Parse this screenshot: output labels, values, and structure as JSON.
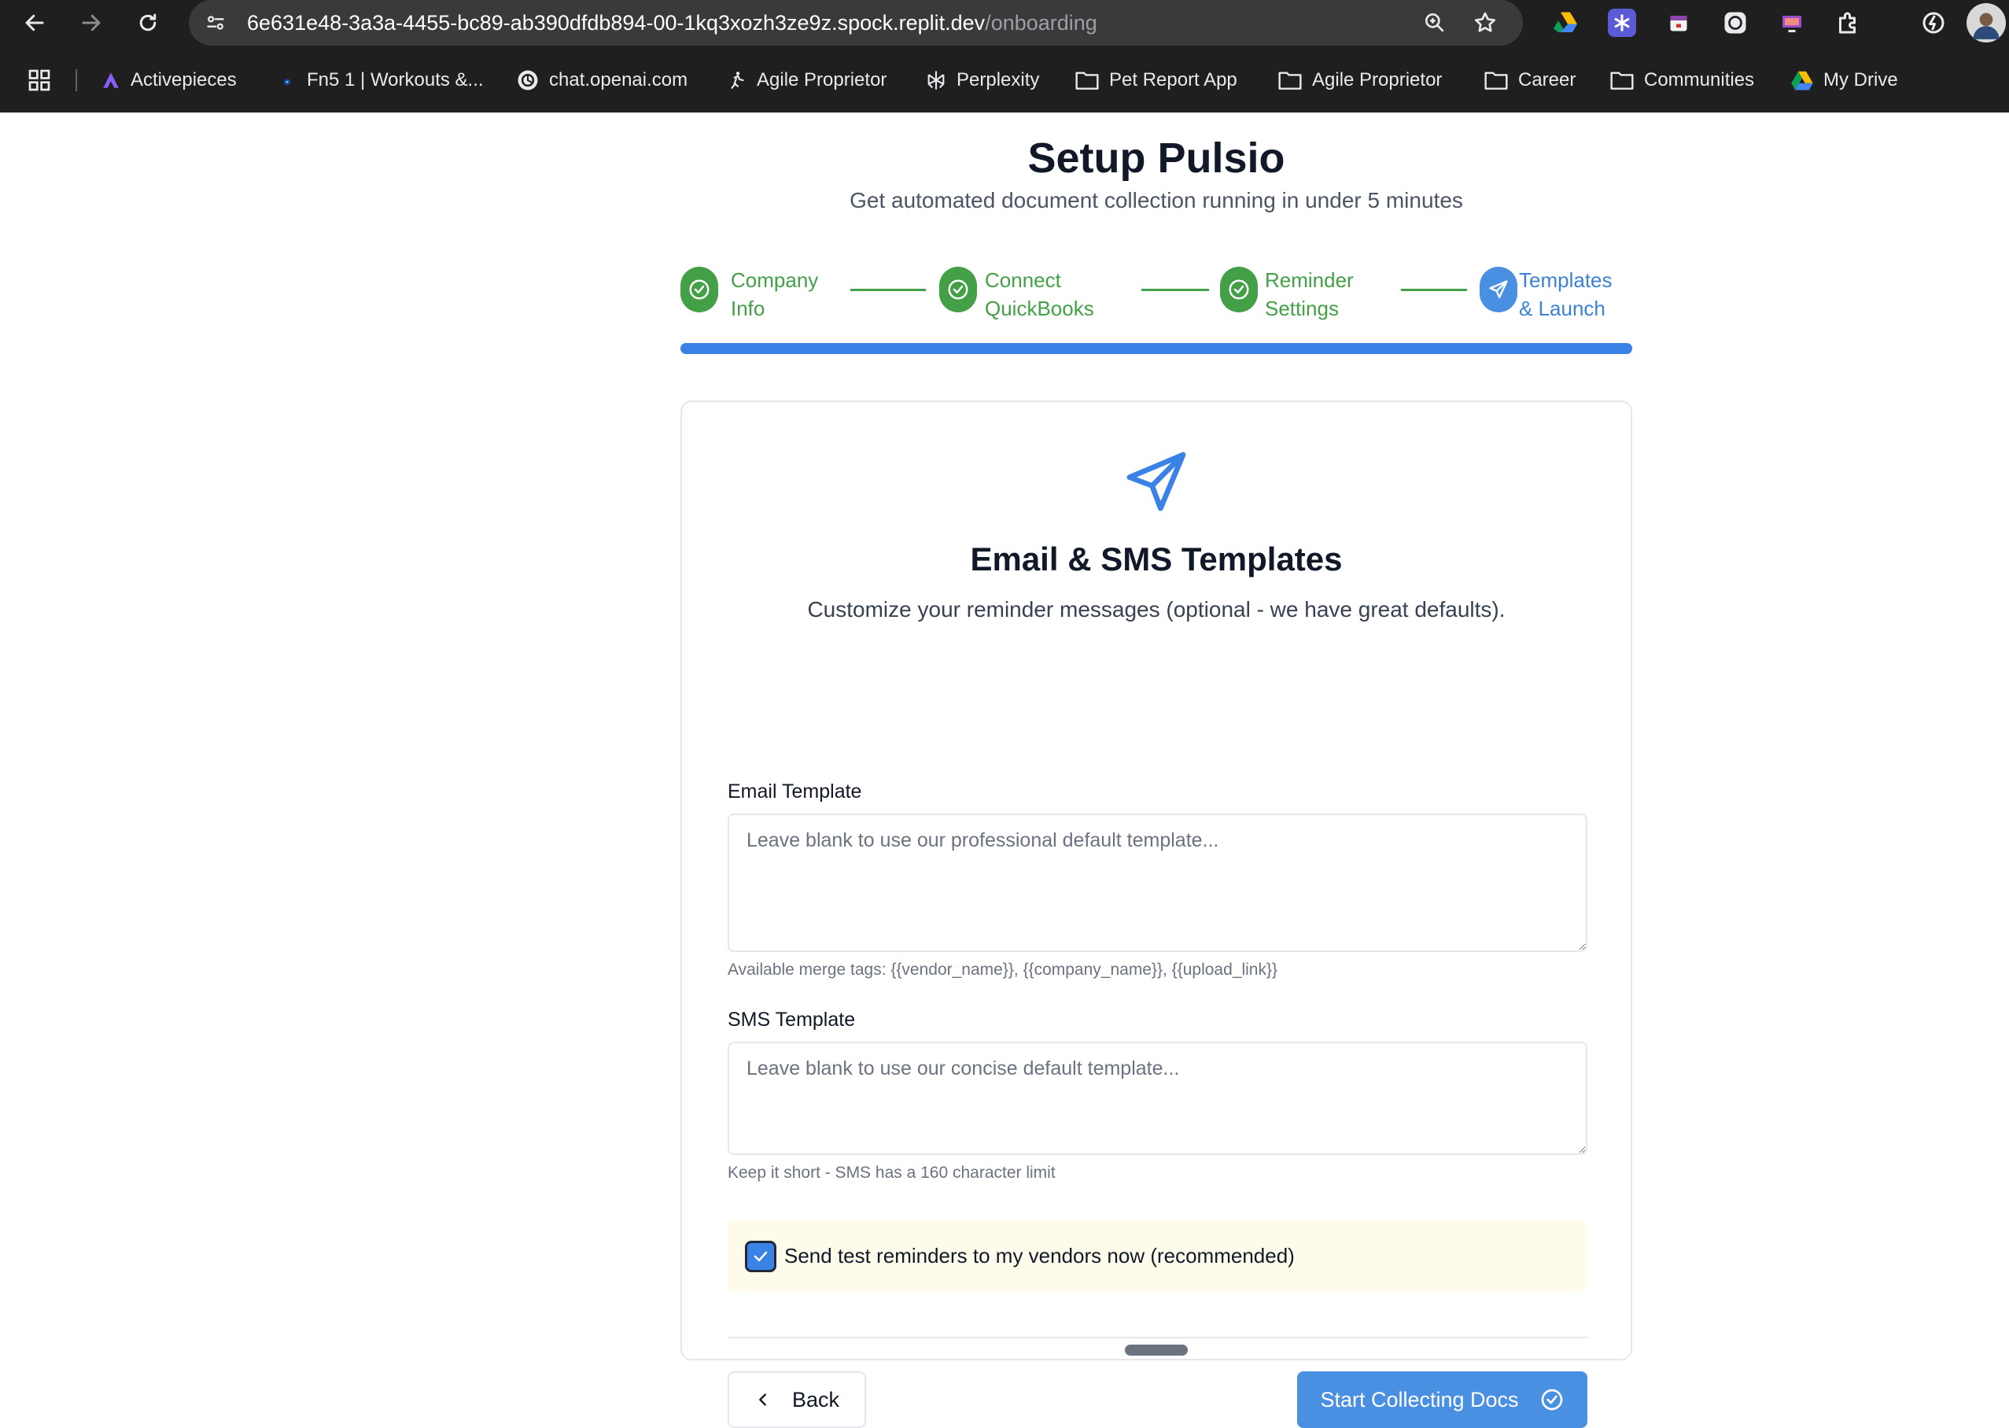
{
  "browser": {
    "url_host": "6e631e48-3a3a-4455-bc89-ab390dfdb894-00-1kq3xozh3ze9z.spock.replit.dev",
    "url_path": "/onboarding",
    "bookmarks": [
      {
        "label": "Activepieces",
        "icon": "activepieces-icon"
      },
      {
        "label": "Fn5 1 | Workouts &...",
        "icon": "fn5-icon"
      },
      {
        "label": "chat.openai.com",
        "icon": "openai-icon"
      },
      {
        "label": "Agile Proprietor",
        "icon": "agile-icon"
      },
      {
        "label": "Perplexity",
        "icon": "perplexity-icon"
      },
      {
        "label": "Pet Report App",
        "icon": "folder-icon"
      },
      {
        "label": "Agile Proprietor",
        "icon": "folder-icon"
      },
      {
        "label": "Career",
        "icon": "folder-icon"
      },
      {
        "label": "Communities",
        "icon": "folder-icon"
      },
      {
        "label": "My Drive",
        "icon": "drive-icon"
      }
    ]
  },
  "page": {
    "title": "Setup Pulsio",
    "subtitle": "Get automated document collection running in under 5 minutes"
  },
  "steps": [
    {
      "line1": "Company",
      "line2": "Info",
      "status": "done"
    },
    {
      "line1": "Connect",
      "line2": "QuickBooks",
      "status": "done"
    },
    {
      "line1": "Reminder",
      "line2": "Settings",
      "status": "done"
    },
    {
      "line1": "Templates",
      "line2": "& Launch",
      "status": "active"
    }
  ],
  "progress_fraction": 1.0,
  "card": {
    "title": "Email & SMS Templates",
    "description": "Customize your reminder messages (optional - we have great defaults).",
    "email": {
      "label": "Email Template",
      "placeholder": "Leave blank to use our professional default template...",
      "value": "",
      "hint": "Available merge tags: {{vendor_name}}, {{company_name}}, {{upload_link}}"
    },
    "sms": {
      "label": "SMS Template",
      "placeholder": "Leave blank to use our concise default template...",
      "value": "",
      "hint": "Keep it short - SMS has a 160 character limit"
    },
    "test_reminders": {
      "label": "Send test reminders to my vendors now (recommended)",
      "checked": true
    },
    "back_label": "Back",
    "submit_label": "Start Collecting Docs"
  },
  "colors": {
    "done": "#43a047",
    "active": "#3b82e6",
    "primary_button": "#4a90e2",
    "test_box_bg": "#fffbeb"
  }
}
